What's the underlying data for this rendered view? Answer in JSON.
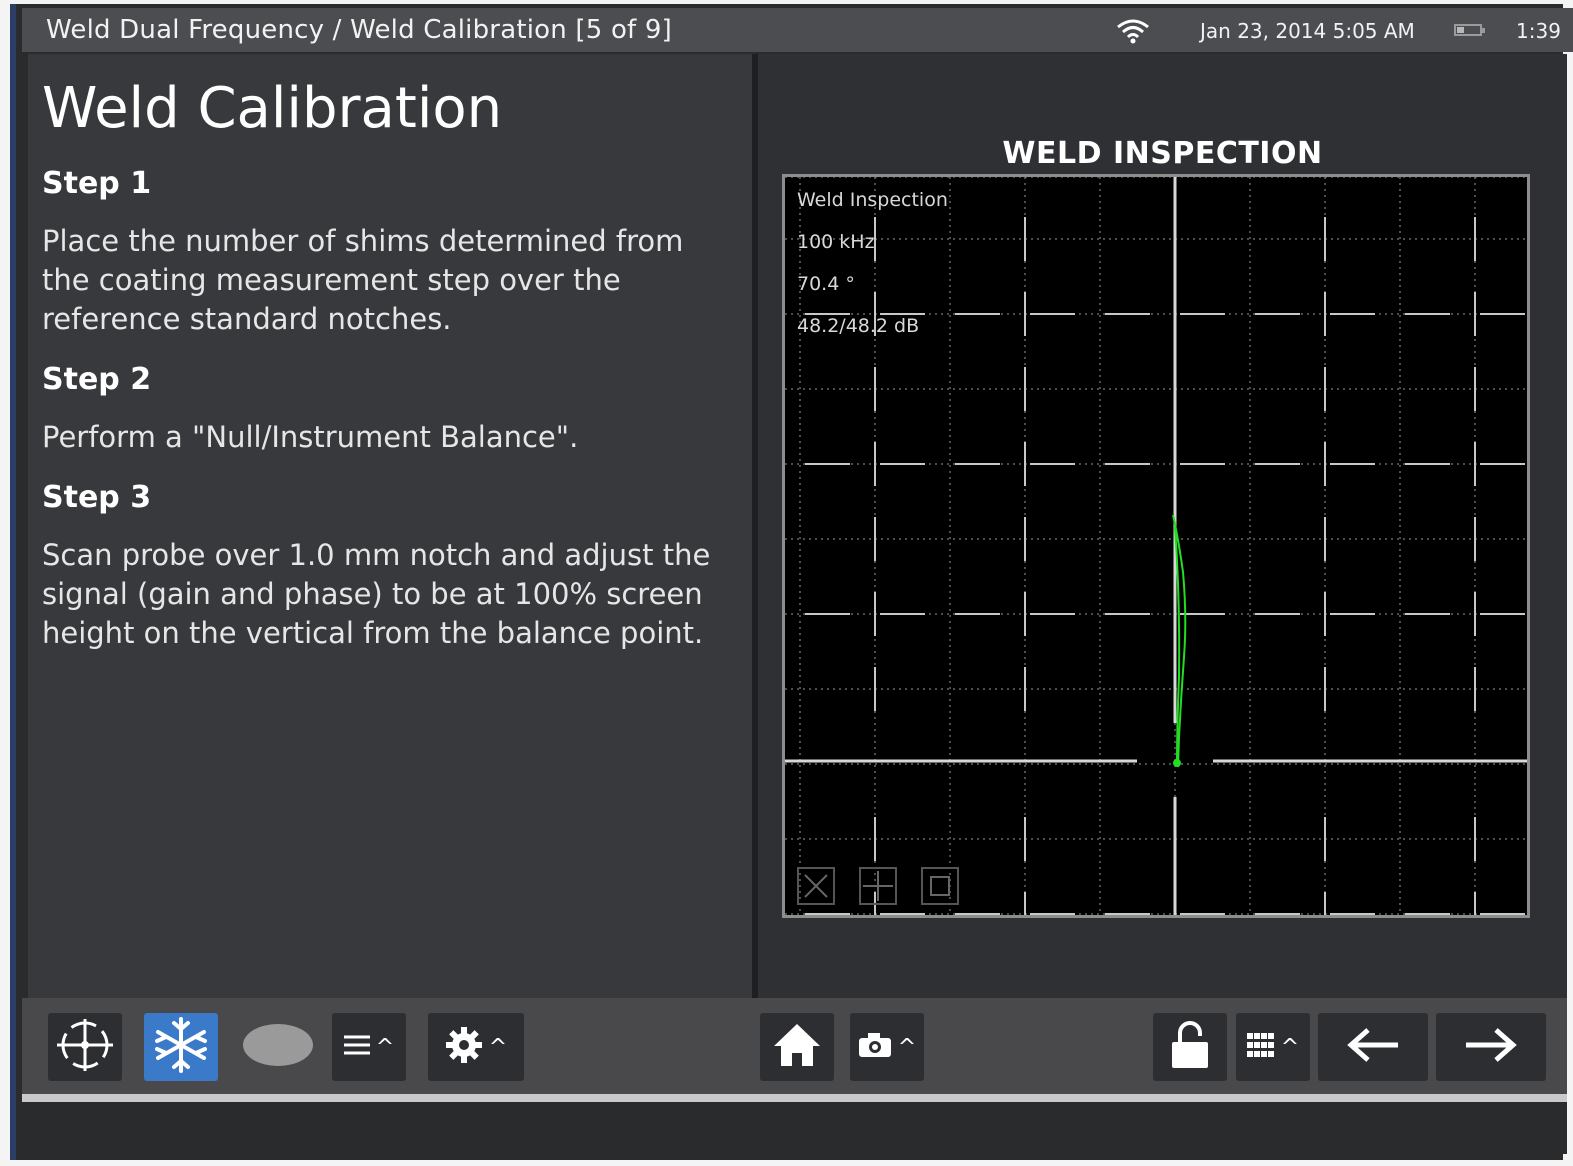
{
  "status_bar": {
    "breadcrumb": "Weld Dual Frequency  / Weld Calibration  [5 of 9]",
    "datetime": "Jan 23, 2014  5:05 AM",
    "time_remaining": "1:39",
    "battery_level": 0.3,
    "wifi_icon": "wifi-icon"
  },
  "instructions": {
    "title": "Weld Calibration",
    "steps": [
      {
        "heading": "Step 1",
        "text": "Place the number of shims determined from the coating measurement step over the reference standard notches."
      },
      {
        "heading": "Step 2",
        "text": "Perform a \"Null/Instrument Balance\"."
      },
      {
        "heading": "Step 3",
        "text": "Scan probe over 1.0 mm notch and adjust the signal (gain and phase) to be at 100% screen height on the vertical from the balance point."
      }
    ]
  },
  "display": {
    "title": "WELD INSPECTION",
    "readouts": {
      "mode": "Weld Inspection",
      "frequency": "100 kHz",
      "phase": "70.4 °",
      "gain": "48.2/48.2 dB"
    },
    "signal_color": "#22dd22",
    "icons": [
      "erase-icon",
      "grid-icon",
      "fullscreen-icon"
    ]
  },
  "toolbar": {
    "buttons": [
      {
        "name": "null-balance-button",
        "icon": "crosshair-icon",
        "active": false
      },
      {
        "name": "freeze-button",
        "icon": "snowflake-icon",
        "active": true
      },
      {
        "name": "erase-button",
        "icon": "ellipse-icon",
        "active": false
      },
      {
        "name": "menu-button",
        "icon": "menu-icon",
        "active": false
      },
      {
        "name": "settings-button",
        "icon": "gear-icon",
        "active": false
      },
      {
        "name": "home-button",
        "icon": "home-icon",
        "active": false
      },
      {
        "name": "camera-button",
        "icon": "camera-icon",
        "active": false
      },
      {
        "name": "lock-button",
        "icon": "unlock-icon",
        "active": false
      },
      {
        "name": "keypad-button",
        "icon": "keypad-icon",
        "active": false
      },
      {
        "name": "back-button",
        "icon": "arrow-left-icon",
        "active": false
      },
      {
        "name": "forward-button",
        "icon": "arrow-right-icon",
        "active": false
      }
    ]
  },
  "colors": {
    "accent": "#3b79c9",
    "panel": "#38393c",
    "toolbar": "#49494c"
  }
}
